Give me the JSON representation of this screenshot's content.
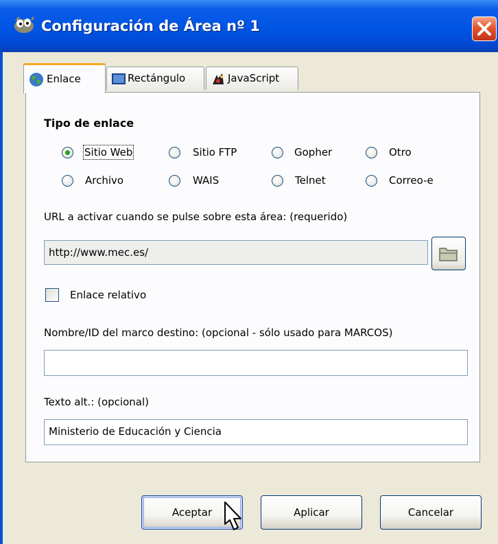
{
  "window": {
    "title": "Configuración de Área nº 1",
    "close_icon": "close-icon",
    "app_icon": "gimp-icon"
  },
  "tabs": [
    {
      "label": "Enlace",
      "icon": "globe-icon",
      "active": true
    },
    {
      "label": "Rectángulo",
      "icon": "rectangle-icon",
      "active": false
    },
    {
      "label": "JavaScript",
      "icon": "javascript-icon",
      "active": false
    }
  ],
  "link_type": {
    "title": "Tipo de enlace",
    "options": [
      {
        "label": "Sitio Web",
        "selected": true
      },
      {
        "label": "Sitio FTP",
        "selected": false
      },
      {
        "label": "Gopher",
        "selected": false
      },
      {
        "label": "Otro",
        "selected": false
      },
      {
        "label": "Archivo",
        "selected": false
      },
      {
        "label": "WAIS",
        "selected": false
      },
      {
        "label": "Telnet",
        "selected": false
      },
      {
        "label": "Correo-e",
        "selected": false
      }
    ]
  },
  "url": {
    "label": "URL a activar cuando se pulse sobre esta área: (requerido)",
    "value": "http://www.mec.es/",
    "browse_icon": "folder-icon"
  },
  "relative_link": {
    "label": "Enlace relativo",
    "checked": false
  },
  "target_frame": {
    "label": "Nombre/ID del marco destino: (opcional - sólo usado para MARCOS)",
    "value": ""
  },
  "alt_text": {
    "label": "Texto alt.: (opcional)",
    "value": "Ministerio de Educación y Ciencia"
  },
  "buttons": {
    "accept": "Aceptar",
    "apply": "Aplicar",
    "cancel": "Cancelar"
  },
  "colors": {
    "titlebar": "#0054e3",
    "tab_highlight": "#f6a71f",
    "radio_selected": "#21a121",
    "close_button": "#e2572f"
  }
}
